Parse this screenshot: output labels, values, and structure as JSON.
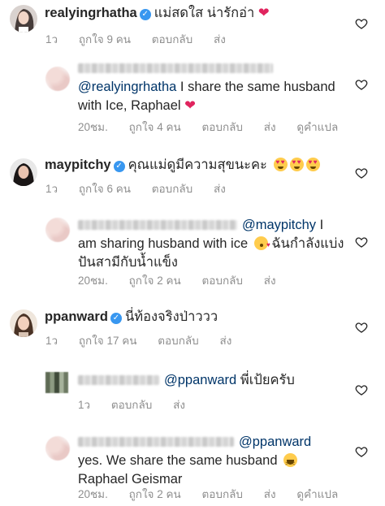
{
  "comments": [
    {
      "username": "realyingrhatha",
      "text": "แม่สดใส น่ารักอ่า",
      "emoji": "red-heart",
      "time": "1ว",
      "likes": "ถูกใจ 9 คน",
      "reply": "ตอบกลับ",
      "send": "ส่ง"
    },
    {
      "mention": "@realyingrhatha",
      "text_line1": "I share the same husband",
      "text_line2": "with Ice, Raphael",
      "emoji": "red-heart",
      "time": "20ชม.",
      "likes": "ถูกใจ 4 คน",
      "reply": "ตอบกลับ",
      "send": "ส่ง",
      "translate": "ดูคำแปล"
    },
    {
      "username": "maypitchy",
      "text": "คุณแม่ดูมีความสุขนะคะ",
      "emoji": "smiling-face-with-heart-eyes x3",
      "time": "1ว",
      "likes": "ถูกใจ 6 คน",
      "reply": "ตอบกลับ",
      "send": "ส่ง"
    },
    {
      "mention": "@maypitchy",
      "text_after_mention": "I",
      "text_line2": "am sharing husband with ice",
      "text_line2_thai": "ฉันกำลังแบ่ง",
      "text_line3": "ปันสามีกับน้ำแข็ง",
      "emoji": "face-blowing-a-kiss",
      "time": "20ชม.",
      "likes": "ถูกใจ 2 คน",
      "reply": "ตอบกลับ",
      "send": "ส่ง"
    },
    {
      "username": "ppanward",
      "text": "นี่ท้องจริงป่าววว",
      "time": "1ว",
      "likes": "ถูกใจ 17 คน",
      "reply": "ตอบกลับ",
      "send": "ส่ง"
    },
    {
      "mention": "@ppanward",
      "text": "พี่เป้ยครับ",
      "time": "1ว",
      "reply": "ตอบกลับ",
      "send": "ส่ง"
    },
    {
      "mention": "@ppanward",
      "text_line2": "yes. We share the same husband",
      "text_line3": "Raphael Geismar",
      "emoji": "grinning-squinting-face",
      "time": "20ชม.",
      "likes": "ถูกใจ 2 คน",
      "reply": "ตอบกลับ",
      "send": "ส่ง",
      "translate": "ดูคำแปล"
    }
  ],
  "icons": {
    "like": "heart-outline-icon",
    "verified": "verified-badge-icon"
  },
  "colors": {
    "text": "#262626",
    "meta": "#8e8e8e",
    "mention": "#003569",
    "verified": "#3897f0",
    "heart_emoji": "#e0245e"
  }
}
